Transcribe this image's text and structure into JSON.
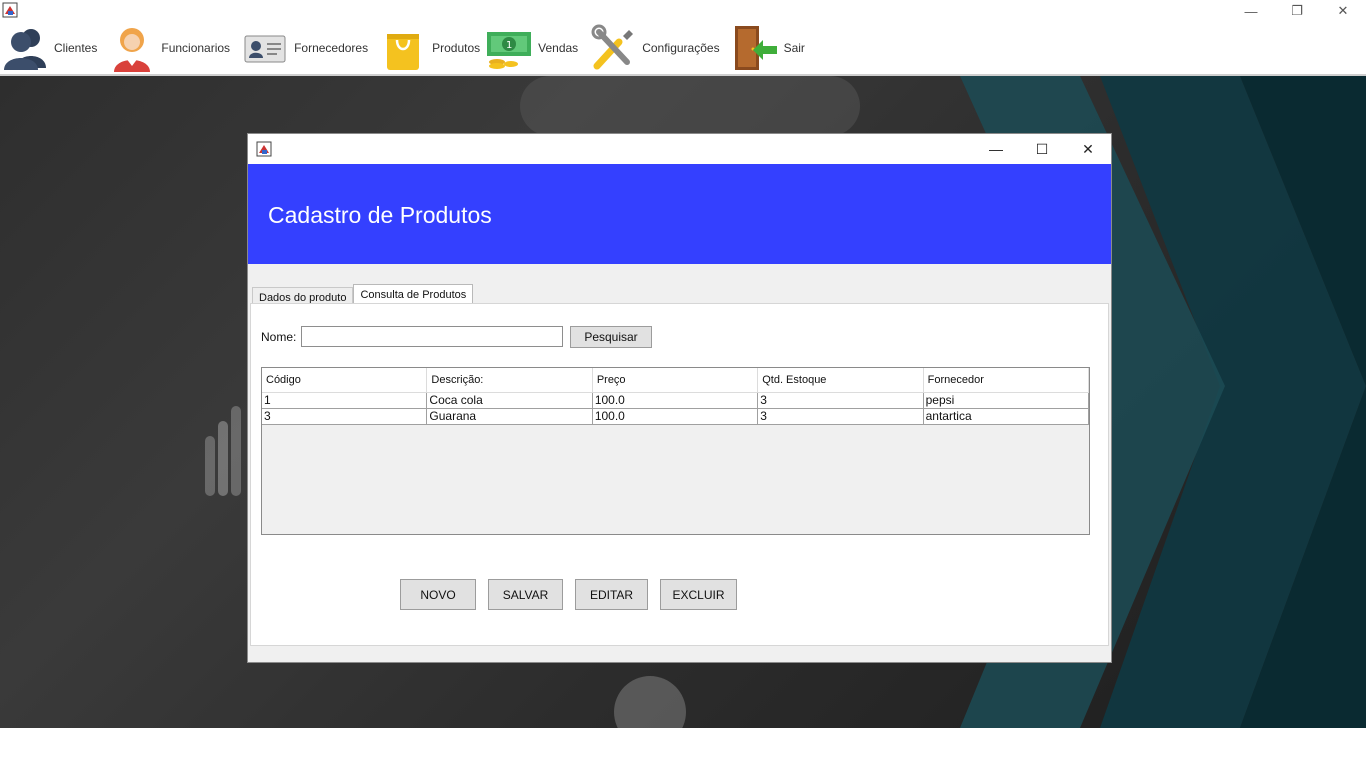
{
  "window": {
    "minimize": "—",
    "restore": "❐",
    "close": "✕"
  },
  "toolbar": {
    "items": [
      {
        "label": "Clientes",
        "icon": "clientes-icon"
      },
      {
        "label": "Funcionarios",
        "icon": "funcionarios-icon"
      },
      {
        "label": "Fornecedores",
        "icon": "fornecedores-icon"
      },
      {
        "label": "Produtos",
        "icon": "produtos-icon"
      },
      {
        "label": "Vendas",
        "icon": "vendas-icon"
      },
      {
        "label": "Configurações",
        "icon": "configuracoes-icon"
      },
      {
        "label": "Sair",
        "icon": "sair-icon"
      }
    ]
  },
  "dialog": {
    "title": "Cadastro de Produtos",
    "controls": {
      "minimize": "—",
      "maximize": "☐",
      "close": "✕"
    },
    "tabs": [
      {
        "label": "Dados do produto"
      },
      {
        "label": "Consulta de Produtos"
      }
    ],
    "search": {
      "label": "Nome:",
      "value": "",
      "button": "Pesquisar"
    },
    "table": {
      "columns": [
        "Código",
        "Descrição:",
        "Preço",
        "Qtd. Estoque",
        "Fornecedor"
      ],
      "rows": [
        [
          "1",
          "Coca cola",
          "100.0",
          "3",
          "pepsi"
        ],
        [
          "3",
          "Guarana",
          "100.0",
          "3",
          "antartica"
        ]
      ]
    },
    "buttons": {
      "novo": "NOVO",
      "salvar": "SALVAR",
      "editar": "EDITAR",
      "excluir": "EXCLUIR"
    },
    "accent_color": "#3440ff"
  }
}
